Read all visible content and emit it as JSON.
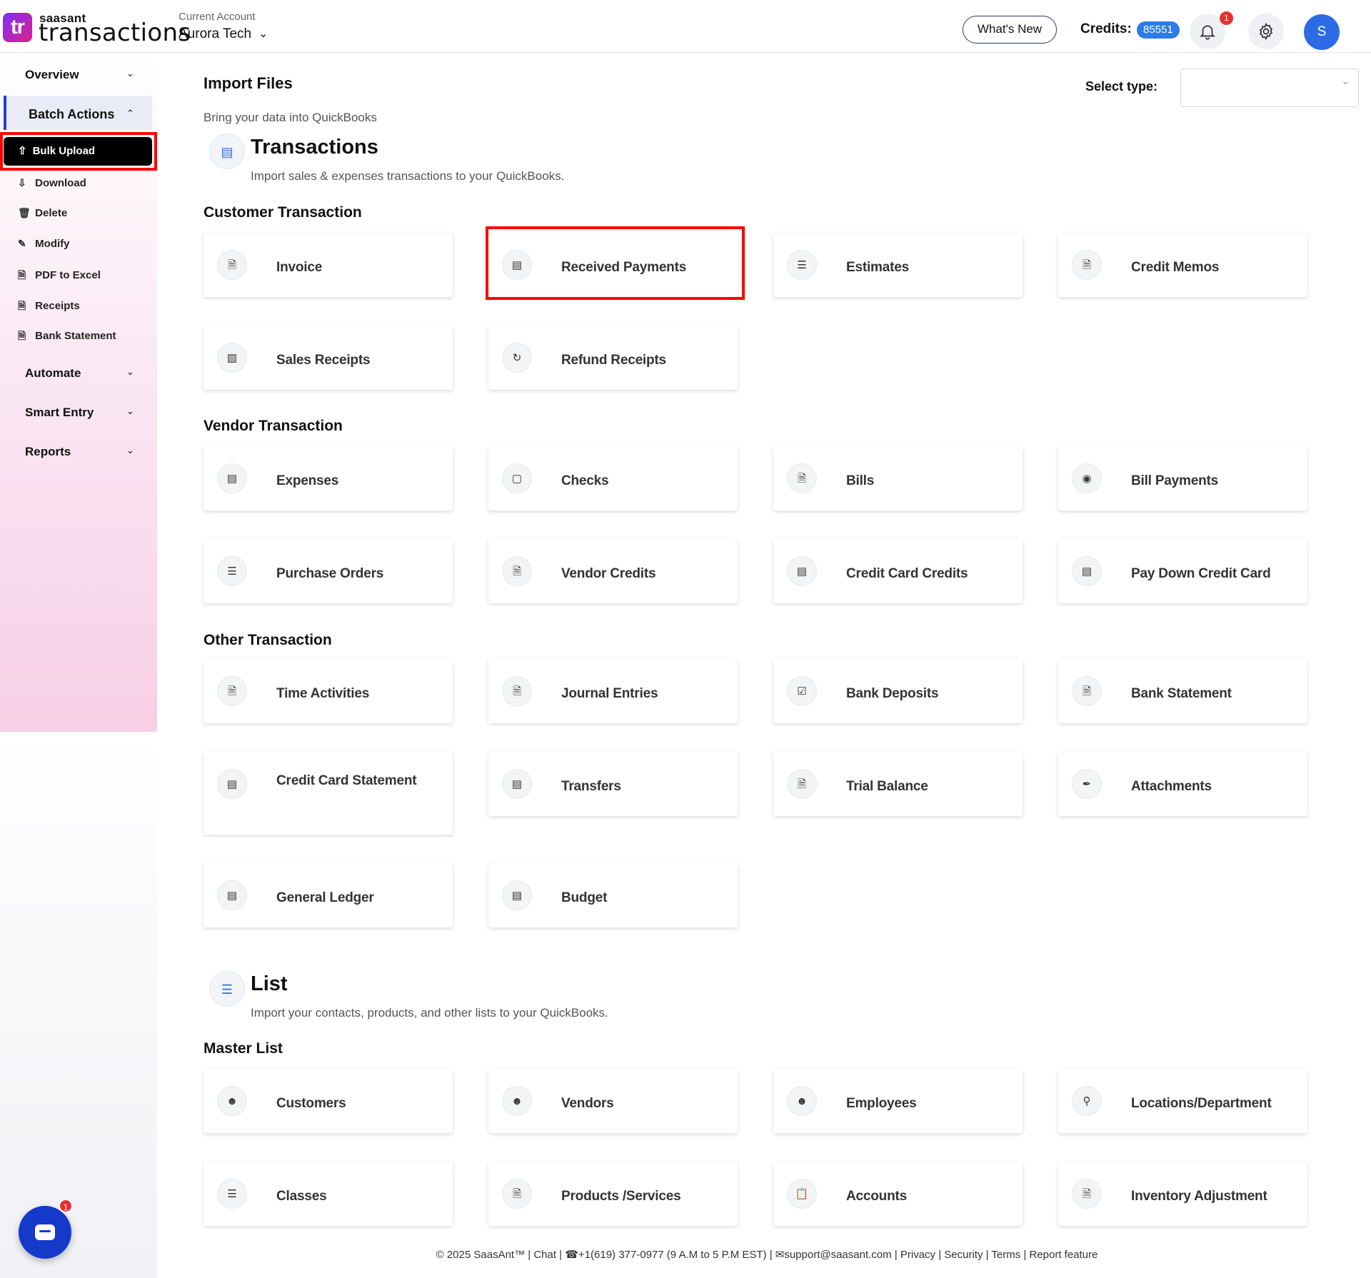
{
  "header": {
    "logo_mark": "tr",
    "logo_sub": "saasant",
    "logo_main": "transactions",
    "account_label": "Current Account",
    "account_name": "Aurora Tech",
    "whats_new": "What's New",
    "credits_label": "Credits:",
    "credits_value": "85551",
    "notification_count": "1",
    "avatar_initial": "S"
  },
  "sidebar": {
    "overview": "Overview",
    "batch_actions": "Batch Actions",
    "sub_items": [
      "Bulk Upload",
      "Download",
      "Delete",
      "Modify",
      "PDF to Excel",
      "Receipts",
      "Bank Statement"
    ],
    "automate": "Automate",
    "smart_entry": "Smart Entry",
    "reports": "Reports",
    "chat_badge": "1"
  },
  "main": {
    "title": "Import Files",
    "subtitle": "Bring your data into QuickBooks",
    "select_type_label": "Select type:",
    "transactions_title": "Transactions",
    "transactions_sub": "Import sales & expenses transactions to your QuickBooks.",
    "customer_title": "Customer Transaction",
    "customer_cards": [
      "Invoice",
      "Received Payments",
      "Estimates",
      "Credit Memos",
      "Sales Receipts",
      "Refund Receipts"
    ],
    "vendor_title": "Vendor Transaction",
    "vendor_cards": [
      "Expenses",
      "Checks",
      "Bills",
      "Bill Payments",
      "Purchase Orders",
      "Vendor Credits",
      "Credit Card Credits",
      "Pay Down Credit Card"
    ],
    "other_title": "Other Transaction",
    "other_cards": [
      "Time Activities",
      "Journal Entries",
      "Bank Deposits",
      "Bank Statement",
      "Credit Card Statement",
      "Transfers",
      "Trial Balance",
      "Attachments",
      "General Ledger",
      "Budget"
    ],
    "list_title": "List",
    "list_sub": "Import your contacts, products, and other lists to your QuickBooks.",
    "master_title": "Master List",
    "master_cards": [
      "Customers",
      "Vendors",
      "Employees",
      "Locations/Department",
      "Classes",
      "Products /Services",
      "Accounts",
      "Inventory Adjustment"
    ]
  },
  "footer": {
    "text": "© 2025 SaasAnt™  | Chat  |  ☎+1(619) 377-0977 (9 A.M to 5 P.M EST)  |  ✉support@saasant.com  | Privacy  | Security  | Terms  | Report feature"
  },
  "colors": {
    "accent": "#2d6be5",
    "credits_badge": "#2d7be8",
    "highlight": "#ff0000",
    "active_bar": "#2b3bd6"
  }
}
